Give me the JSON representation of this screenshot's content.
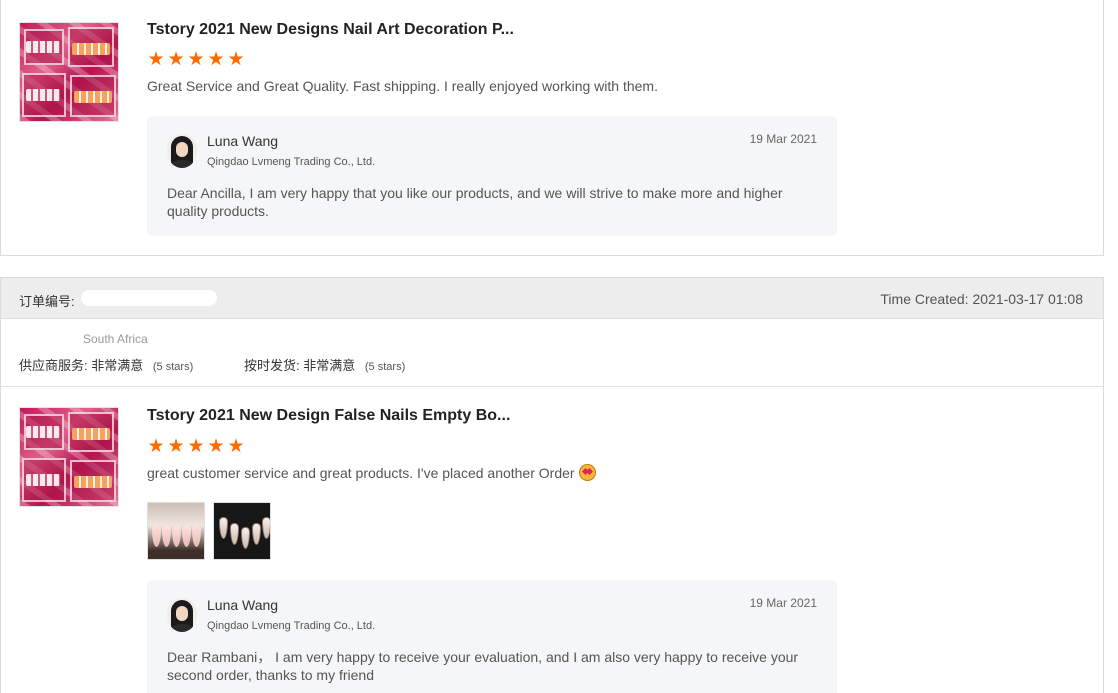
{
  "reviews": [
    {
      "title": "Tstory 2021 New Designs Nail Art Decoration P...",
      "stars": 5,
      "star_glyph": "★",
      "text": "Great Service and Great Quality. Fast shipping. I really enjoyed working with them.",
      "reply": {
        "name": "Luna Wang",
        "company": "Qingdao Lvmeng Trading Co., Ltd.",
        "date": "19 Mar 2021",
        "text": "Dear Ancilla, I am very happy that you like our products, and we will strive to make more and higher quality products."
      }
    },
    {
      "title": "Tstory 2021 New Design False Nails Empty Bo...",
      "stars": 5,
      "star_glyph": "★",
      "text": "great customer service and great products. I've placed another Order",
      "emoji": "star-struck-emoji",
      "reply": {
        "name": "Luna Wang",
        "company": "Qingdao Lvmeng Trading Co., Ltd.",
        "date": "19 Mar 2021",
        "text": "Dear Rambani， I am very happy to receive your evaluation, and I am also very happy to receive your second order, thanks to my friend"
      }
    }
  ],
  "order": {
    "number_label": "订单编号:",
    "time_created": "Time Created: 2021-03-17 01:08",
    "country": "South Africa",
    "supplier_service_label": "供应商服务:",
    "supplier_service_value": "非常满意",
    "supplier_service_stars": "(5 stars)",
    "on_time_label": "按时发货:",
    "on_time_value": "非常满意",
    "on_time_stars": "(5 stars)"
  },
  "colors": {
    "star": "#ff6a00",
    "reply_bg": "#f5f6f8",
    "header_bg": "#ededed"
  }
}
